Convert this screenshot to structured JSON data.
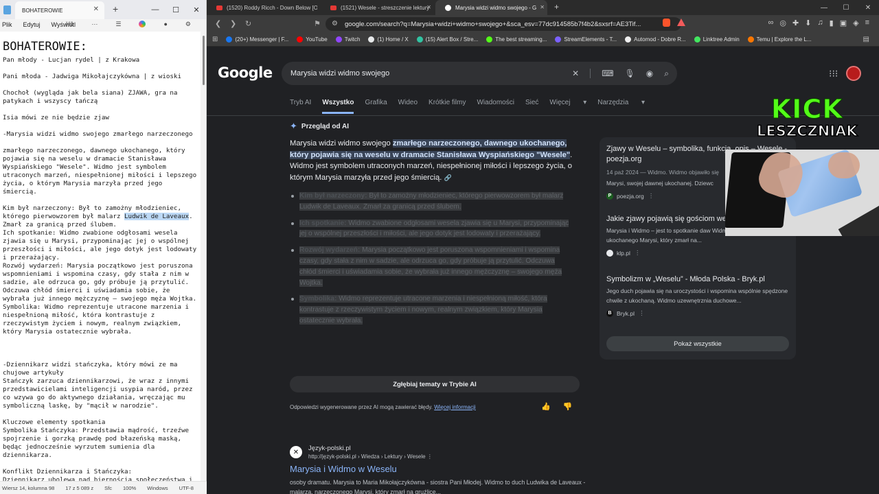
{
  "notepad": {
    "tab_title": "BOHATEROWIE",
    "menu": [
      "Plik",
      "Edytuj",
      "Wyświetl"
    ],
    "heading_select": "H1",
    "more_label": "···",
    "heading": "BOHATEROWIE:",
    "lines": [
      "Pan młody - Lucjan rydel | z Krakowa",
      "",
      "Pani młoda - Jadwiga Mikołajczykówna | z wioski",
      "",
      "Chochoł (wygląda jak bela siana) ZJAWA, gra na patykach i wszyscy tańczą",
      "",
      "Isia mówi ze nie będzie zjaw",
      "",
      "-Marysia widzi widmo swojego zmarłego narzeczonego",
      "",
      "zmarłego narzeczonego, dawnego ukochanego, który pojawia się na weselu w dramacie Stanisława Wyspiańskiego \"Wesele\". Widmo jest symbolem utraconych marzeń, niespełnionej miłości i lepszego życia, o którym Marysia marzyła przed jego śmiercią.",
      "",
      "Kim był narzeczony: Był to zamożny młodzieniec, którego pierwowzorem był malarz ",
      "Zmarł za granicą przed ślubem.",
      "Ich spotkanie: Widmo zwabione odgłosami wesela zjawia się u Marysi, przypominając jej o wspólnej przeszłości i miłości, ale jego dotyk jest lodowaty i przerażający.",
      "Rozwój wydarzeń: Marysia początkowo jest poruszona wspomnieniami i wspomina czasy, gdy stała z nim w sadzie, ale odrzuca go, gdy próbuje ją przytulić. Odczuwa chłód śmierci i uświadamia sobie, że wybrała już innego mężczyznę – swojego męża Wojtka.",
      "Symbolika: Widmo reprezentuje utracone marzenia i niespełnioną miłość, która kontrastuje z rzeczywistym życiem i nowym, realnym związkiem, który Marysia ostatecznie wybrała.",
      "",
      "",
      "",
      "-Dziennikarz widzi stańczyka, który mówi ze ma chujowe artykuły",
      "Stańczyk zarzuca dziennikarzowi, że wraz z innymi przedstawicielami inteligencji usypia naród, przez co wzywa go do aktywnego działania, wręczając mu symboliczną laskę, by \"mącił w narodzie\".",
      "",
      "Kluczowe elementy spotkania",
      "Symbolika Stańczyka: Przedstawia mądrość, trzeźwe spojrzenie i gorzką prawdę pod błazeńską maską, będąc jednocześnie wyrzutem sumienia dla dziennikarza.",
      "",
      "Konflikt Dziennikarza i Stańczyka:",
      "Dziennikarz ubolewa nad biernością społeczeństwa i utratą ducha walki, ale sam jest bierny i nieświadomy"
    ],
    "highlight": "Ludwik de Laveaux",
    "highlight_suffix": ".",
    "status": {
      "position": "Wiersz 14, kolumna 98",
      "chars": "17 z 5 089 z",
      "format": "Sfc",
      "zoom": "100%",
      "eol": "Windows",
      "encoding": "UTF-8"
    }
  },
  "browser": {
    "tabs": [
      {
        "title": "(1520) Roddy Ricch - Down Below [O"
      },
      {
        "title": "(1521) Wesele - streszczenie lektury"
      },
      {
        "title": "Marysia widzi widmo swojego - G"
      }
    ],
    "url": "google.com/search?q=Marysia+widzi+widmo+swojego+&sca_esv=77dc914585b7f4b2&sxsrf=AE3Tif...",
    "bookmarks": [
      {
        "label": "(20+) Messenger | F...",
        "color": "#1877f2"
      },
      {
        "label": "YouTube",
        "color": "#ff0000"
      },
      {
        "label": "Twitch",
        "color": "#9146ff"
      },
      {
        "label": "(1) Home / X",
        "color": "#e7e9ea"
      },
      {
        "label": "(15) Alert Box / Stre...",
        "color": "#31c3a2"
      },
      {
        "label": "The best streaming...",
        "color": "#53fc18"
      },
      {
        "label": "StreamElements - T...",
        "color": "#7b61ff"
      },
      {
        "label": "Automod - Dobre R...",
        "color": "#f0f0f0"
      },
      {
        "label": "Linktree Admin",
        "color": "#43e660"
      },
      {
        "label": "Temu | Explore the L...",
        "color": "#fb7701"
      }
    ]
  },
  "google": {
    "logo": "Google",
    "query": "Marysia widzi widmo swojego",
    "tabs": [
      "Tryb AI",
      "Wszystko",
      "Grafika",
      "Wideo",
      "Krótkie filmy",
      "Wiadomości",
      "Sieć",
      "Więcej",
      "Narzędzia"
    ],
    "ai_title": "Przegląd od AI",
    "ai_intro_prefix": "Marysia widzi widmo swojego ",
    "ai_intro_mark": "zmarłego narzeczonego, dawnego ukochanego, który pojawia się na weselu w dramacie Stanisława Wyspiańskiego \"Wesele\"",
    "ai_intro_suffix": ". Widmo jest symbolem utraconych marzeń, niespełnionej miłości i lepszego życia, o którym Marysia marzyła przed jego śmiercią.",
    "ai_items": [
      {
        "label": "Kim był narzeczony:",
        "text": " Był to zamożny młodzieniec, którego pierwowzorem był malarz Ludwik de Laveaux. Zmarł za granicą przed ślubem."
      },
      {
        "label": "Ich spotkanie:",
        "text": " Widmo zwabione odgłosami wesela zjawia się u Marysi, przypominając jej o wspólnej przeszłości i miłości, ale jego dotyk jest lodowaty i przerażający."
      },
      {
        "label": "Rozwój wydarzeń:",
        "text": " Marysia początkowo jest poruszona wspomnieniami i wspomina czasy, gdy stała z nim w sadzie, ale odrzuca go, gdy próbuje ją przytulić. Odczuwa chłód śmierci i uświadamia sobie, że wybrała już innego mężczyznę – swojego męża Wojtka."
      },
      {
        "label": "Symbolika:",
        "text": " Widmo reprezentuje utracone marzenia i niespełnioną miłość, która kontrastuje z rzeczywistym życiem i nowym, realnym związkiem, który Marysia ostatecznie wybrała."
      }
    ],
    "explore_label": "Zgłębiaj tematy w Trybie AI",
    "disclaimer": "Odpowiedzi wygenerowane przez AI mogą zawierać błędy.",
    "disclaimer_link": "Więcej informacji",
    "side_cards": [
      {
        "title": "Zjawy w Weselu – symbolika, funkcja, opis – Wesele - poezja.org",
        "date": "14 paź 2024 — Widmo. Widmo objawiło się",
        "desc": "Marysi, swojej dawnej ukochanej. Dziewc",
        "source": "poezja.org",
        "fav": "P",
        "fav_bg": "#1b5e20"
      },
      {
        "title": "Jakie zjawy pojawią się gościom we",
        "date": "",
        "desc": "Marysia i Widmo – jest to spotkanie daw Widmo to duch byłego ukochanego Marysi, który zmarł na...",
        "source": "klp.pl",
        "fav": "",
        "fav_bg": "#e8eaed"
      },
      {
        "title": "Symbolizm w „Weselu” - Młoda Polska - Bryk.pl",
        "date": "",
        "desc": "Jego duch pojawia się na uroczystości i wspomina wspólnie spędzone chwile z ukochaną. Widmo uzewnętrznia duchowe...",
        "source": "Bryk.pl",
        "fav": "B",
        "fav_bg": "#111111"
      }
    ],
    "show_all": "Pokaż wszystkie",
    "result": {
      "site": "Język-polski.pl",
      "crumb": "http://język-polski.pl › Wiedza › Lektury › Wesele",
      "title": "Marysia i Widmo w Weselu",
      "snippet": "osoby dramatu. Marysia to Maria Mikołajczykówna - siostra Pani Młodej. Widmo to duch Ludwika de Laveaux - malarza, narzeczonego Marysi, który zmarł na gruźlicę..."
    }
  },
  "overlay": {
    "kick_logo": "KICK",
    "streamer": "LESZCZNIAK"
  }
}
